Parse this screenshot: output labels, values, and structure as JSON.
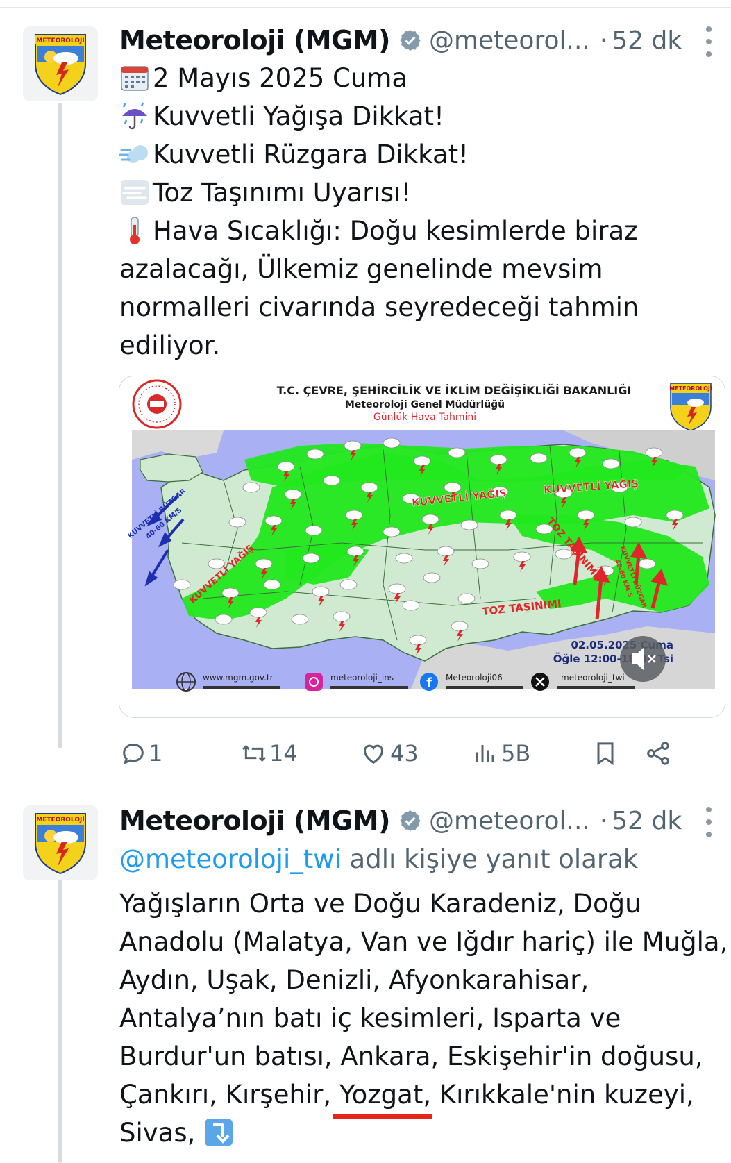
{
  "tweets": [
    {
      "author_name": "Meteoroloji (MGM)",
      "handle": "@meteorol...",
      "separator": "·",
      "time": "52 dk",
      "lines": [
        {
          "icon": "calendar-emoji",
          "text": "2 Mayıs 2025 Cuma"
        },
        {
          "icon": "umbrella-rain-emoji",
          "text": "Kuvvetli Yağışa Dikkat!"
        },
        {
          "icon": "wind-emoji",
          "text": "Kuvvetli Rüzgara Dikkat!"
        },
        {
          "icon": "fog-emoji",
          "text": "Toz Taşınımı Uyarısı!"
        },
        {
          "icon": "thermometer-emoji",
          "text": "Hava Sıcaklığı: Doğu kesimlerde biraz"
        },
        {
          "icon": "",
          "text": "azalacağı, Ülkemiz genelinde mevsim"
        },
        {
          "icon": "",
          "text": "normalleri civarında seyredeceği tahmin"
        },
        {
          "icon": "",
          "text": "ediliyor."
        }
      ],
      "media": {
        "ministry_title": "T.C. ÇEVRE, ŞEHİRCİLİK VE İKLİM DEĞİŞİKLİĞİ BAKANLIĞI",
        "directorate": "Meteoroloji Genel Müdürlüğü",
        "subtitle": "Günlük Hava Tahmini",
        "logo_text": "METEOROLOJİ",
        "map_labels": {
          "heavy_rain_center": "KUVVETLİ YAĞIŞ",
          "heavy_rain_east": "KUVVETLİ YAĞIŞ",
          "heavy_rain_west": "KUVVETLİ YAĞIŞ",
          "dust_south": "TOZ TAŞINIMI",
          "dust_east": "TOZ TAŞINIMI",
          "wind_west": "KUVVETLİ RÜZGAR",
          "wind_west_speed": "40-60 KM/S",
          "wind_east": "KUVVETLİ RÜZGAR",
          "wind_east_speed": "40-60 KM/S"
        },
        "date_line": "02.05.2025 Cuma",
        "time_line": "Öğle 12:00-18:00 Tsi",
        "footer": [
          {
            "icon": "globe-icon",
            "text": "www.mgm.gov.tr"
          },
          {
            "icon": "instagram-icon",
            "text": "meteoroloji_ins"
          },
          {
            "icon": "facebook-icon",
            "text": "Meteoroloji06"
          },
          {
            "icon": "x-logo-icon",
            "text": "meteoroloji_twi"
          }
        ]
      },
      "stats": {
        "replies": "1",
        "retweets": "14",
        "likes": "43",
        "views": "5B"
      }
    },
    {
      "author_name": "Meteoroloji (MGM)",
      "handle": "@meteorol...",
      "separator": "·",
      "time": "52 dk",
      "reply_mention": "@meteoroloji_twi",
      "reply_suffix": " adlı kişiye yanıt olarak",
      "lines": [
        "Yağışların Orta ve Doğu Karadeniz, Doğu",
        "Anadolu (Malatya, Van ve Iğdır hariç) ile Muğla,",
        "Aydın, Uşak, Denizli, Afyonkarahisar,",
        "Antalya’nın batı iç kesimleri, Isparta ve",
        "Burdur'un batısı, Ankara, Eskişehir'in doğusu,",
        "Çankırı, Kırşehir, Yozgat, Kırıkkale'nin kuzeyi,",
        "Sivas,"
      ],
      "last_line_icon": "arrow-down-emoji"
    }
  ],
  "colors": {
    "map_green": "#22e81e",
    "map_land": "#cfead0",
    "sea": "#aab0f4",
    "mention_blue": "#1d9bf0",
    "verified_gray": "#829aab",
    "underline_red": "#e8241a"
  }
}
